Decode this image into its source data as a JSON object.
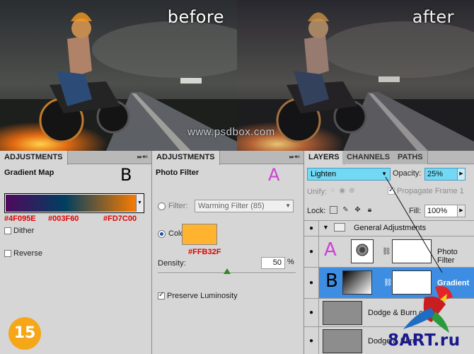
{
  "photos": {
    "before_label": "before",
    "after_label": "after",
    "watermark": "www.psdbox.com"
  },
  "adjustments_left": {
    "tab_label": "ADJUSTMENTS",
    "panel_title": "Gradient Map",
    "marker": "B",
    "gradient_stops": [
      "#4F095E",
      "#003F60",
      "#FD7C00"
    ],
    "dither_label": "Dither",
    "dither_checked": false,
    "reverse_label": "Reverse",
    "reverse_checked": false
  },
  "adjustments_right": {
    "tab_label": "ADJUSTMENTS",
    "panel_title": "Photo Filter",
    "marker": "A",
    "filter_label": "Filter:",
    "filter_value": "Warming Filter (85)",
    "color_label": "Color:",
    "color_hex": "#FFB32F",
    "density_label": "Density:",
    "density_value": "50",
    "density_unit": "%",
    "density_fraction": 0.5,
    "preserve_label": "Preserve Luminosity",
    "preserve_checked": true
  },
  "layers": {
    "tabs": [
      "LAYERS",
      "CHANNELS",
      "PATHS"
    ],
    "active_tab": "LAYERS",
    "blend_mode": "Lighten",
    "opacity_label": "Opacity:",
    "opacity_value": "25%",
    "unify_label": "Unify:",
    "propagate_label": "Propagate Frame 1",
    "lock_label": "Lock:",
    "fill_label": "Fill:",
    "fill_value": "100%",
    "group_name": "General Adjustments",
    "rows": [
      {
        "marker": "A",
        "name": "Photo Filter"
      },
      {
        "marker": "B",
        "name": "Gradient"
      },
      {
        "name": "Dodge & Burn copy"
      },
      {
        "name": "Dodge & Burn"
      }
    ]
  },
  "footer": {
    "step_number": "15",
    "brand": "8ART.ru"
  }
}
